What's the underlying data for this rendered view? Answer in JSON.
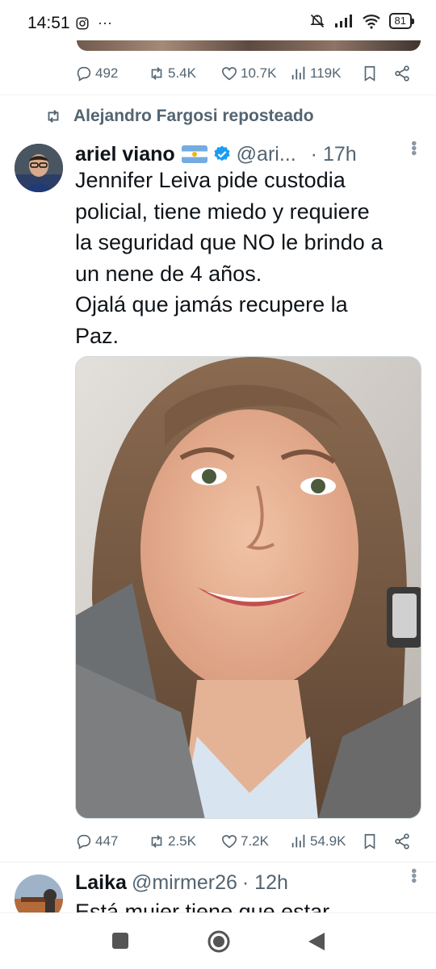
{
  "status_bar": {
    "time": "14:51",
    "left_icons": [
      "instagram-icon",
      "more-dots-icon"
    ],
    "right_icons": [
      "mute-icon",
      "signal-icon",
      "wifi-icon",
      "battery-icon"
    ],
    "battery": "81"
  },
  "prev_tweet": {
    "replies": "492",
    "reposts": "5.4K",
    "likes": "10.7K",
    "views": "119K"
  },
  "tweet": {
    "repost_label": "Alejandro Fargosi reposteado",
    "name": "ariel viano",
    "handle": "@ari...",
    "time": "· 17h",
    "text": "Jennifer Leiva pide custodia\npolicial, tiene miedo y requiere\nla seguridad que NO le brindo a\nun nene de 4 años.\nOjalá que jamás recupere la\nPaz.",
    "replies": "447",
    "reposts": "2.5K",
    "likes": "7.2K",
    "views": "54.9K"
  },
  "reply": {
    "name": "Laika",
    "handle": "@mirmer26",
    "time": "· 12h",
    "text": "Está mujer tiene que estar"
  },
  "colors": {
    "text": "#0f1419",
    "secondary": "#536471",
    "verified": "#1d9bf0",
    "divider": "#eff3f4"
  }
}
